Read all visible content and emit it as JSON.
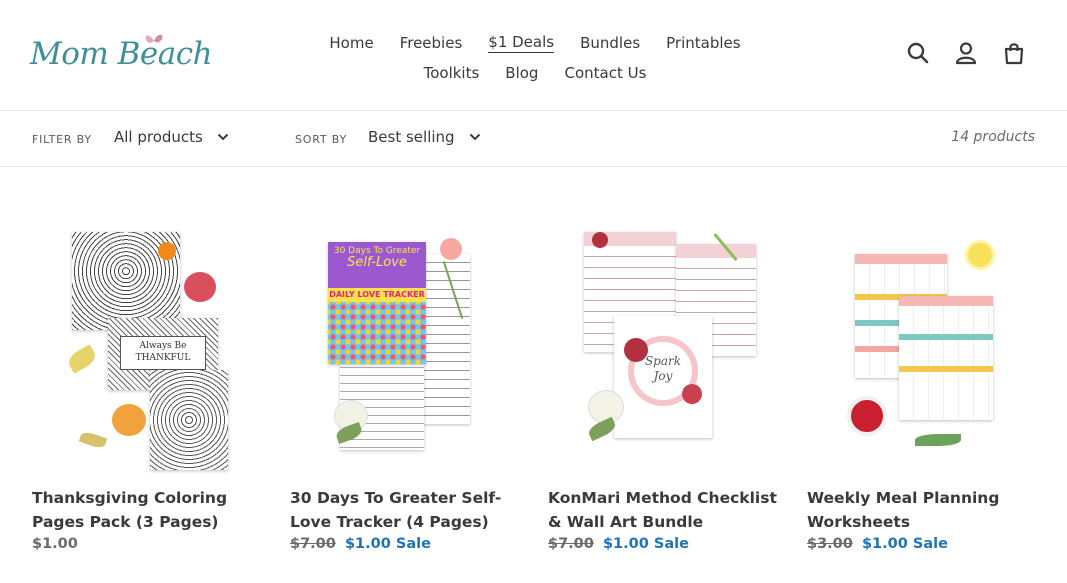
{
  "brand": {
    "logo_text": "Mom Beach"
  },
  "nav": {
    "row1": [
      {
        "label": "Home",
        "active": false
      },
      {
        "label": "Freebies",
        "active": false
      },
      {
        "label": "$1 Deals",
        "active": true
      },
      {
        "label": "Bundles",
        "active": false
      },
      {
        "label": "Printables",
        "active": false
      }
    ],
    "row2": [
      {
        "label": "Toolkits",
        "active": false
      },
      {
        "label": "Blog",
        "active": false
      },
      {
        "label": "Contact Us",
        "active": false
      }
    ]
  },
  "header_icons": [
    "search-icon",
    "account-icon",
    "cart-icon"
  ],
  "filters": {
    "filter_label": "FILTER BY",
    "filter_value": "All products",
    "sort_label": "SORT BY",
    "sort_value": "Best selling",
    "count": "14 products"
  },
  "products": [
    {
      "title": "Thanksgiving Coloring Pages Pack (3 Pages)",
      "title_line1": "Thanksgiving Coloring",
      "title_line2": "Pages Pack (3 Pages)",
      "old_price": "",
      "price": "$1.00",
      "sale_label": ""
    },
    {
      "title": "30 Days To Greater Self-Love Tracker (4 Pages)",
      "title_line1": "30 Days To Greater Self-",
      "title_line2": "Love Tracker (4 Pages)",
      "old_price": "$7.00",
      "price": "$1.00",
      "sale_label": "Sale"
    },
    {
      "title": "KonMari Method Checklist & Wall Art Bundle",
      "title_line1": "KonMari Method Checklist",
      "title_line2": "& Wall Art Bundle",
      "old_price": "$7.00",
      "price": "$1.00",
      "sale_label": "Sale"
    },
    {
      "title": "Weekly Meal Planning Worksheets",
      "title_line1": "Weekly Meal Planning",
      "title_line2": "Worksheets",
      "old_price": "$3.00",
      "price": "$1.00",
      "sale_label": "Sale"
    }
  ],
  "image_text": {
    "p1_badge": "Always Be THANKFUL",
    "p2_head1": "30 Days To Greater",
    "p2_head2": "Self-Love",
    "p2_head3": "DAILY LOVE TRACKER",
    "p3_art1": "Spark",
    "p3_art2": "Joy"
  },
  "colors": {
    "accent_link": "#1f74b8",
    "logo": "#3f8f98",
    "text": "#3a3a3a"
  }
}
